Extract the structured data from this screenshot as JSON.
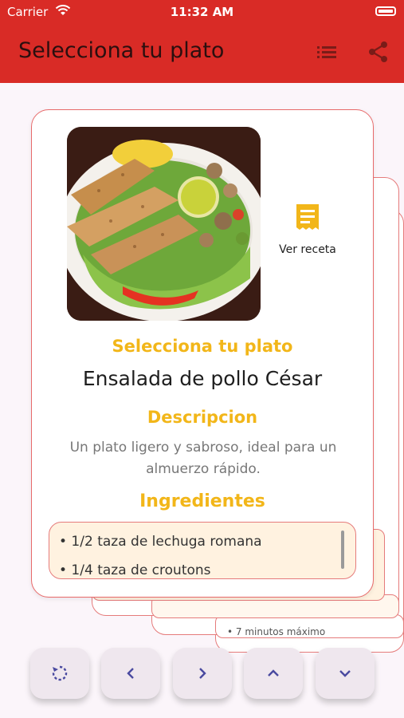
{
  "status_bar": {
    "carrier": "Carrier",
    "time": "11:32 AM"
  },
  "app_bar": {
    "title": "Selecciona tu plato",
    "icons": [
      "list-icon",
      "share-icon"
    ]
  },
  "card": {
    "recipe_button_label": "Ver receta",
    "select_label": "Selecciona tu plato",
    "dish_name": "Ensalada de pollo César",
    "description_heading": "Descripcion",
    "description": "Un plato ligero y sabroso, ideal para un almuerzo rápido.",
    "ingredients_heading": "Ingredientes",
    "ingredients": [
      "• 1/2 taza de lechuga romana",
      "• 1/4 taza de croutons"
    ]
  },
  "background_card_text": "• 7 minutos máximo",
  "controls": [
    "reset-icon",
    "chevron-left-icon",
    "chevron-right-icon",
    "chevron-up-icon",
    "chevron-down-icon"
  ],
  "colors": {
    "primary": "#d92b26",
    "accent": "#f2b619",
    "border": "#e57b7b",
    "ingredients_bg": "#fff2e0"
  }
}
